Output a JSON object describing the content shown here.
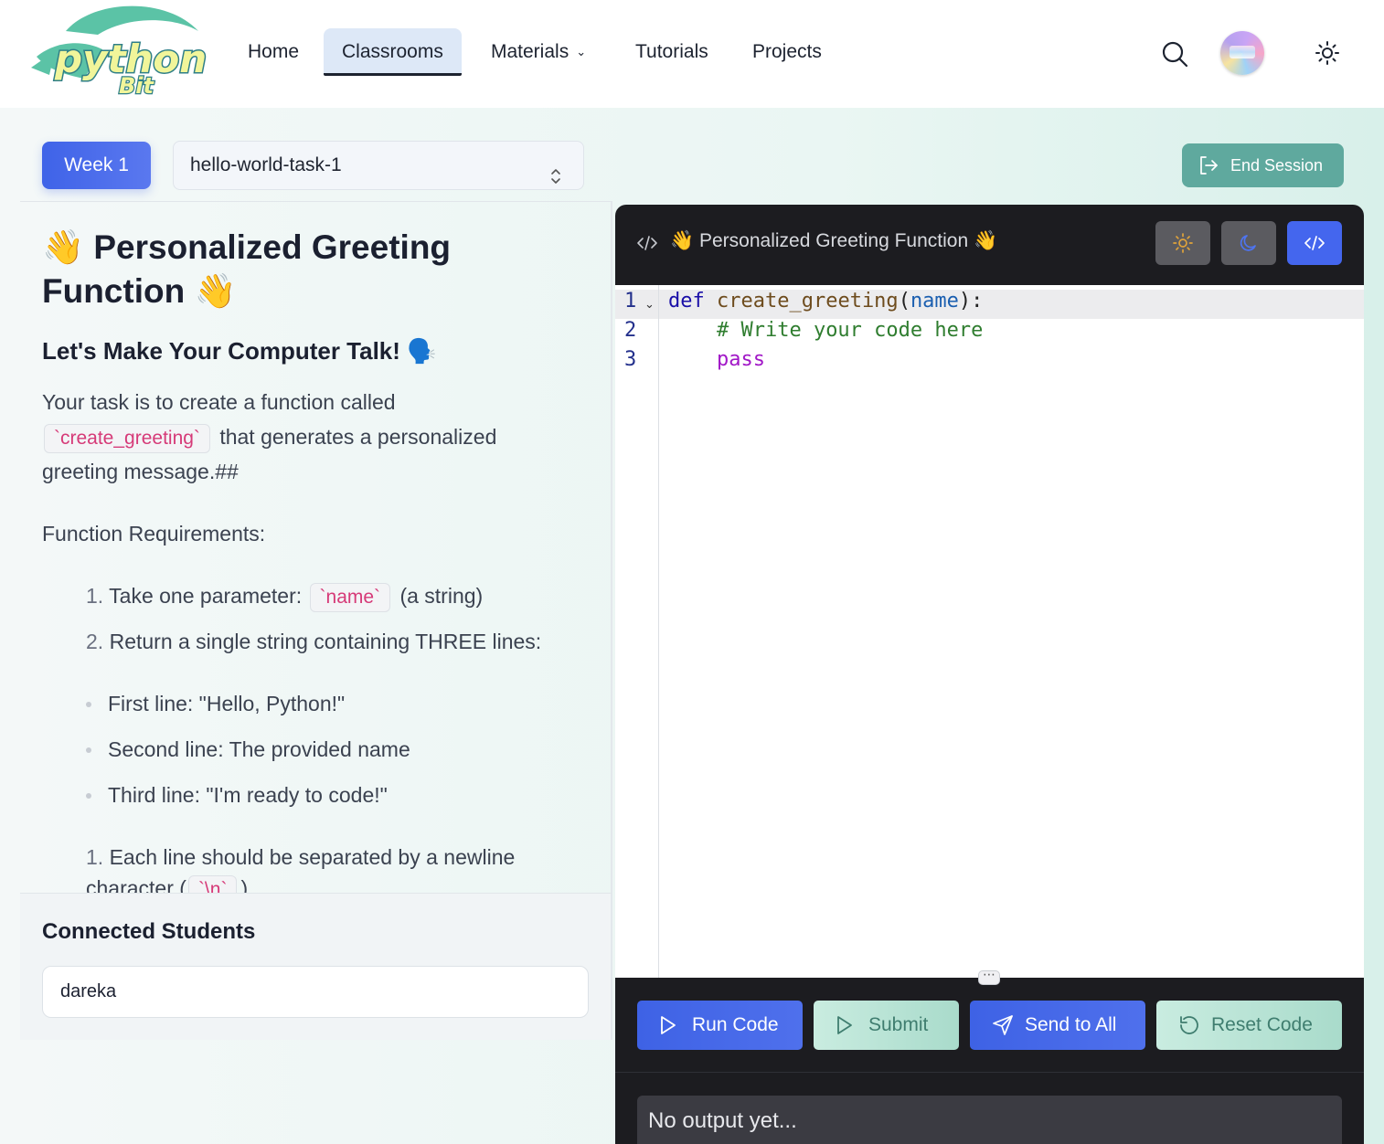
{
  "nav": {
    "logo_text": "python Bit",
    "links": [
      {
        "label": "Home"
      },
      {
        "label": "Classrooms"
      },
      {
        "label": "Materials"
      },
      {
        "label": "Tutorials"
      },
      {
        "label": "Projects"
      }
    ],
    "icons": [
      "search-icon",
      "avatar",
      "sun-icon"
    ]
  },
  "toolbar": {
    "week_label": "Week 1",
    "task_select_value": "hello-world-task-1",
    "end_session_label": "End Session"
  },
  "task": {
    "title": "👋 Personalized Greeting Function 👋",
    "subtitle": "Let's Make Your Computer Talk! 🗣️",
    "intro_before": "Your task is to create a function called",
    "intro_code": "`create_greeting`",
    "intro_after": "that generates a personalized greeting message.##",
    "requirements_heading": "Function Requirements:",
    "req1_num": "1.",
    "req1_before": "Take one parameter:",
    "req1_code": "`name`",
    "req1_after": "(a string)",
    "req2_num": "2.",
    "req2_text": "Return a single string containing THREE lines:",
    "bullets": [
      "First line: \"Hello, Python!\"",
      "Second line: The provided name",
      "Third line: \"I'm ready to code!\""
    ],
    "req3_num": "1.",
    "req3_text": "Each line should be separated by a newline",
    "req3_cont": "character (",
    "req3_code": "`\\n`",
    "req3_end": ")"
  },
  "students": {
    "heading": "Connected Students",
    "list": [
      "dareka"
    ]
  },
  "editor": {
    "title": "👋 Personalized Greeting Function 👋",
    "line_numbers": [
      "1",
      "2",
      "3"
    ],
    "code": {
      "l1_kw": "def",
      "l1_fn": "create_greeting",
      "l1_open": "(",
      "l1_param": "name",
      "l1_close": "):",
      "l2_comment": "# Write your code here",
      "l3_kw": "pass"
    },
    "actions": {
      "run": "Run Code",
      "submit": "Submit",
      "send": "Send to All",
      "reset": "Reset Code"
    },
    "output": "No output yet..."
  },
  "colors": {
    "primary": "#3f63e8",
    "mint": "#a9dbcb",
    "end_session": "#5fa99e",
    "editor_bg": "#1c1c20"
  }
}
